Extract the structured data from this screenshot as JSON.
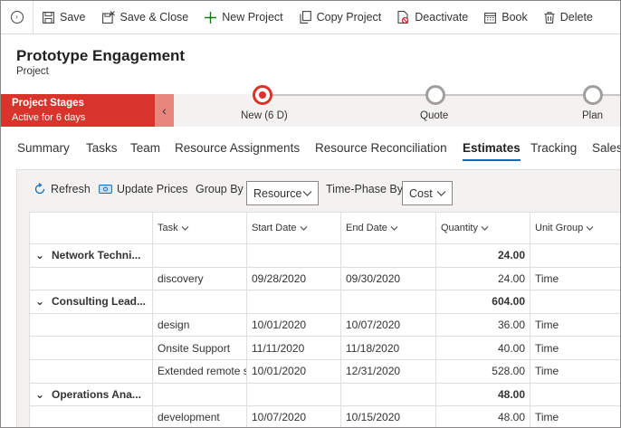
{
  "commands": [
    {
      "label": "Save",
      "icon": "save-icon"
    },
    {
      "label": "Save & Close",
      "icon": "save-close-icon"
    },
    {
      "label": "New Project",
      "icon": "plus-icon"
    },
    {
      "label": "Copy Project",
      "icon": "copy-icon"
    },
    {
      "label": "Deactivate",
      "icon": "deactivate-icon"
    },
    {
      "label": "Book",
      "icon": "book-icon"
    },
    {
      "label": "Delete",
      "icon": "trash-icon"
    }
  ],
  "header": {
    "title": "Prototype Engagement",
    "subtitle": "Project"
  },
  "stages": {
    "badge_title": "Project Stages",
    "badge_sub": "Active for 6 days",
    "items": [
      {
        "label": "New  (6 D)",
        "state": "active"
      },
      {
        "label": "Quote",
        "state": "idle"
      },
      {
        "label": "Plan",
        "state": "idle"
      }
    ]
  },
  "tabs": [
    "Summary",
    "Tasks",
    "Team",
    "Resource Assignments",
    "Resource Reconciliation",
    "Estimates",
    "Tracking",
    "Sales"
  ],
  "selected_tab": "Estimates",
  "toolbar": {
    "refresh": "Refresh",
    "update_prices": "Update Prices",
    "group_by_label": "Group By",
    "group_by_value": "Resource",
    "timephase_label": "Time-Phase By",
    "timephase_value": "Cost"
  },
  "grid": {
    "columns": [
      "Task",
      "Start Date",
      "End Date",
      "Quantity",
      "Unit Group"
    ],
    "groups": [
      {
        "name": "Network Techni...",
        "quantity": "24.00",
        "rows": [
          {
            "task": "discovery",
            "start": "09/28/2020",
            "end": "09/30/2020",
            "quantity": "24.00",
            "unit": "Time"
          }
        ]
      },
      {
        "name": "Consulting Lead...",
        "quantity": "604.00",
        "rows": [
          {
            "task": "design",
            "start": "10/01/2020",
            "end": "10/07/2020",
            "quantity": "36.00",
            "unit": "Time"
          },
          {
            "task": "Onsite Support",
            "start": "11/11/2020",
            "end": "11/18/2020",
            "quantity": "40.00",
            "unit": "Time"
          },
          {
            "task": "Extended remote s",
            "start": "10/01/2020",
            "end": "12/31/2020",
            "quantity": "528.00",
            "unit": "Time"
          }
        ]
      },
      {
        "name": "Operations Ana...",
        "quantity": "48.00",
        "rows": [
          {
            "task": "development",
            "start": "10/07/2020",
            "end": "10/15/2020",
            "quantity": "48.00",
            "unit": "Time"
          }
        ]
      }
    ]
  },
  "colors": {
    "stage_red": "#d9342b",
    "accent_blue": "#0f6cbd"
  }
}
